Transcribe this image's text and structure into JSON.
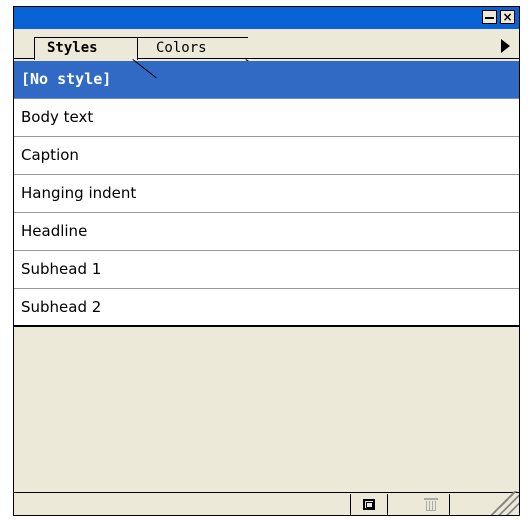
{
  "tabs": [
    {
      "label": "Styles",
      "active": true
    },
    {
      "label": "Colors",
      "active": false
    }
  ],
  "styles": [
    {
      "label": "[No style]",
      "selected": true
    },
    {
      "label": "Body text"
    },
    {
      "label": "Caption"
    },
    {
      "label": "Hanging indent"
    },
    {
      "label": "Headline"
    },
    {
      "label": "Subhead 1"
    },
    {
      "label": "Subhead 2"
    }
  ],
  "colors": {
    "titlebar": "#0a63d6",
    "selection": "#316ac5",
    "panel": "#ece9d8"
  },
  "icons": {
    "minimize": "minimize-icon",
    "close": "close-icon",
    "menu": "triangle-right-icon",
    "new_style": "new-style-icon",
    "delete": "trash-icon",
    "resize": "resize-grip-icon"
  }
}
